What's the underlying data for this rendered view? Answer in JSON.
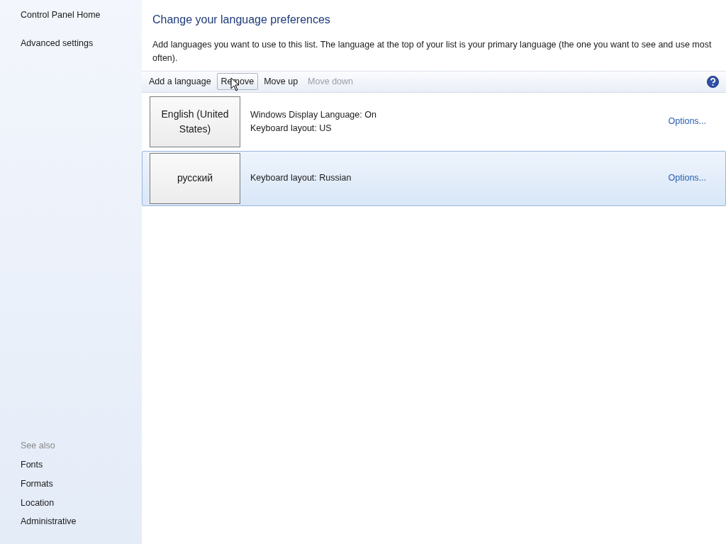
{
  "sidebar": {
    "links": [
      "Control Panel Home",
      "Advanced settings"
    ],
    "see_also": {
      "heading": "See also",
      "links": [
        "Fonts",
        "Formats",
        "Location",
        "Administrative"
      ]
    }
  },
  "header": {
    "title": "Change your language preferences",
    "description": "Add languages you want to use to this list. The language at the top of your list is your primary language (the one you want to see and use most often)."
  },
  "toolbar": {
    "buttons": [
      {
        "label": "Add a language",
        "hover": false,
        "disabled": false
      },
      {
        "label": "Remove",
        "hover": true,
        "disabled": false
      },
      {
        "label": "Move up",
        "hover": false,
        "disabled": false
      },
      {
        "label": "Move down",
        "hover": false,
        "disabled": true
      }
    ]
  },
  "languages": [
    {
      "name": "English (United States)",
      "details": [
        "Windows Display Language: On",
        "Keyboard layout: US"
      ],
      "link": "Options...",
      "selected": false
    },
    {
      "name": "русский",
      "details": [
        "Keyboard layout: Russian"
      ],
      "link": "Options...",
      "selected": true
    }
  ]
}
